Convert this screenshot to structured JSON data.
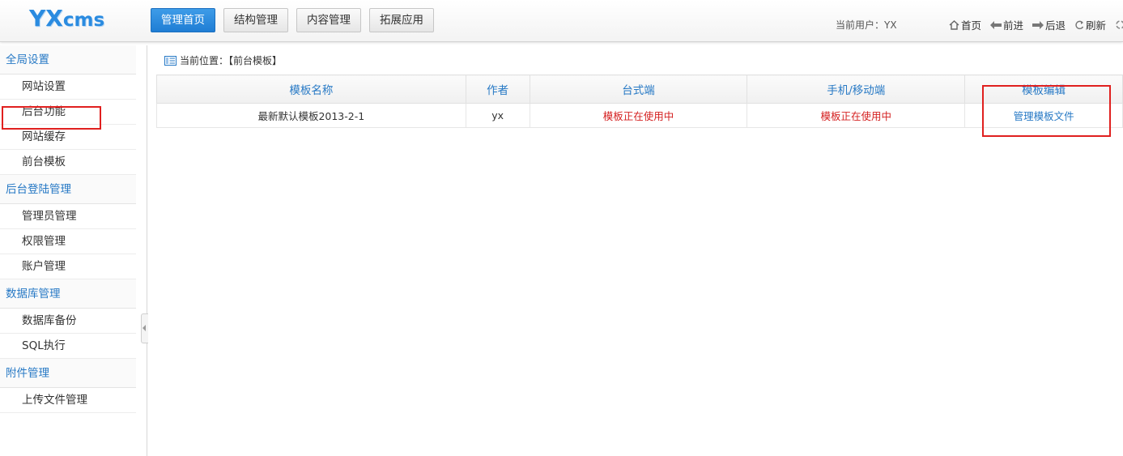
{
  "logo": {
    "main": "YX",
    "suffix": "cms"
  },
  "nav": [
    {
      "label": "管理首页",
      "active": true
    },
    {
      "label": "结构管理",
      "active": false
    },
    {
      "label": "内容管理",
      "active": false
    },
    {
      "label": "拓展应用",
      "active": false
    }
  ],
  "user_text": "当前用户：YX",
  "tools": {
    "home": "首页",
    "forward": "前进",
    "back": "后退",
    "refresh": "刷新"
  },
  "sidebar": {
    "groups": [
      {
        "title": "全局设置",
        "items": [
          "网站设置",
          "后台功能",
          "网站缓存",
          "前台模板"
        ]
      },
      {
        "title": "后台登陆管理",
        "items": [
          "管理员管理",
          "权限管理",
          "账户管理"
        ]
      },
      {
        "title": "数据库管理",
        "items": [
          "数据库备份",
          "SQL执行"
        ]
      },
      {
        "title": "附件管理",
        "items": [
          "上传文件管理"
        ]
      }
    ],
    "selected": "前台模板"
  },
  "breadcrumb": "当前位置：【前台模板】",
  "table": {
    "headers": [
      "模板名称",
      "作者",
      "台式端",
      "手机/移动端",
      "模板编辑"
    ],
    "rows": [
      [
        "最新默认模板2013-2-1",
        "yx",
        "模板正在使用中",
        "模板正在使用中",
        "管理模板文件"
      ]
    ]
  },
  "colors": {
    "accent": "#2779c5",
    "status_red": "#d41f1f",
    "highlight": "#e0201f"
  }
}
